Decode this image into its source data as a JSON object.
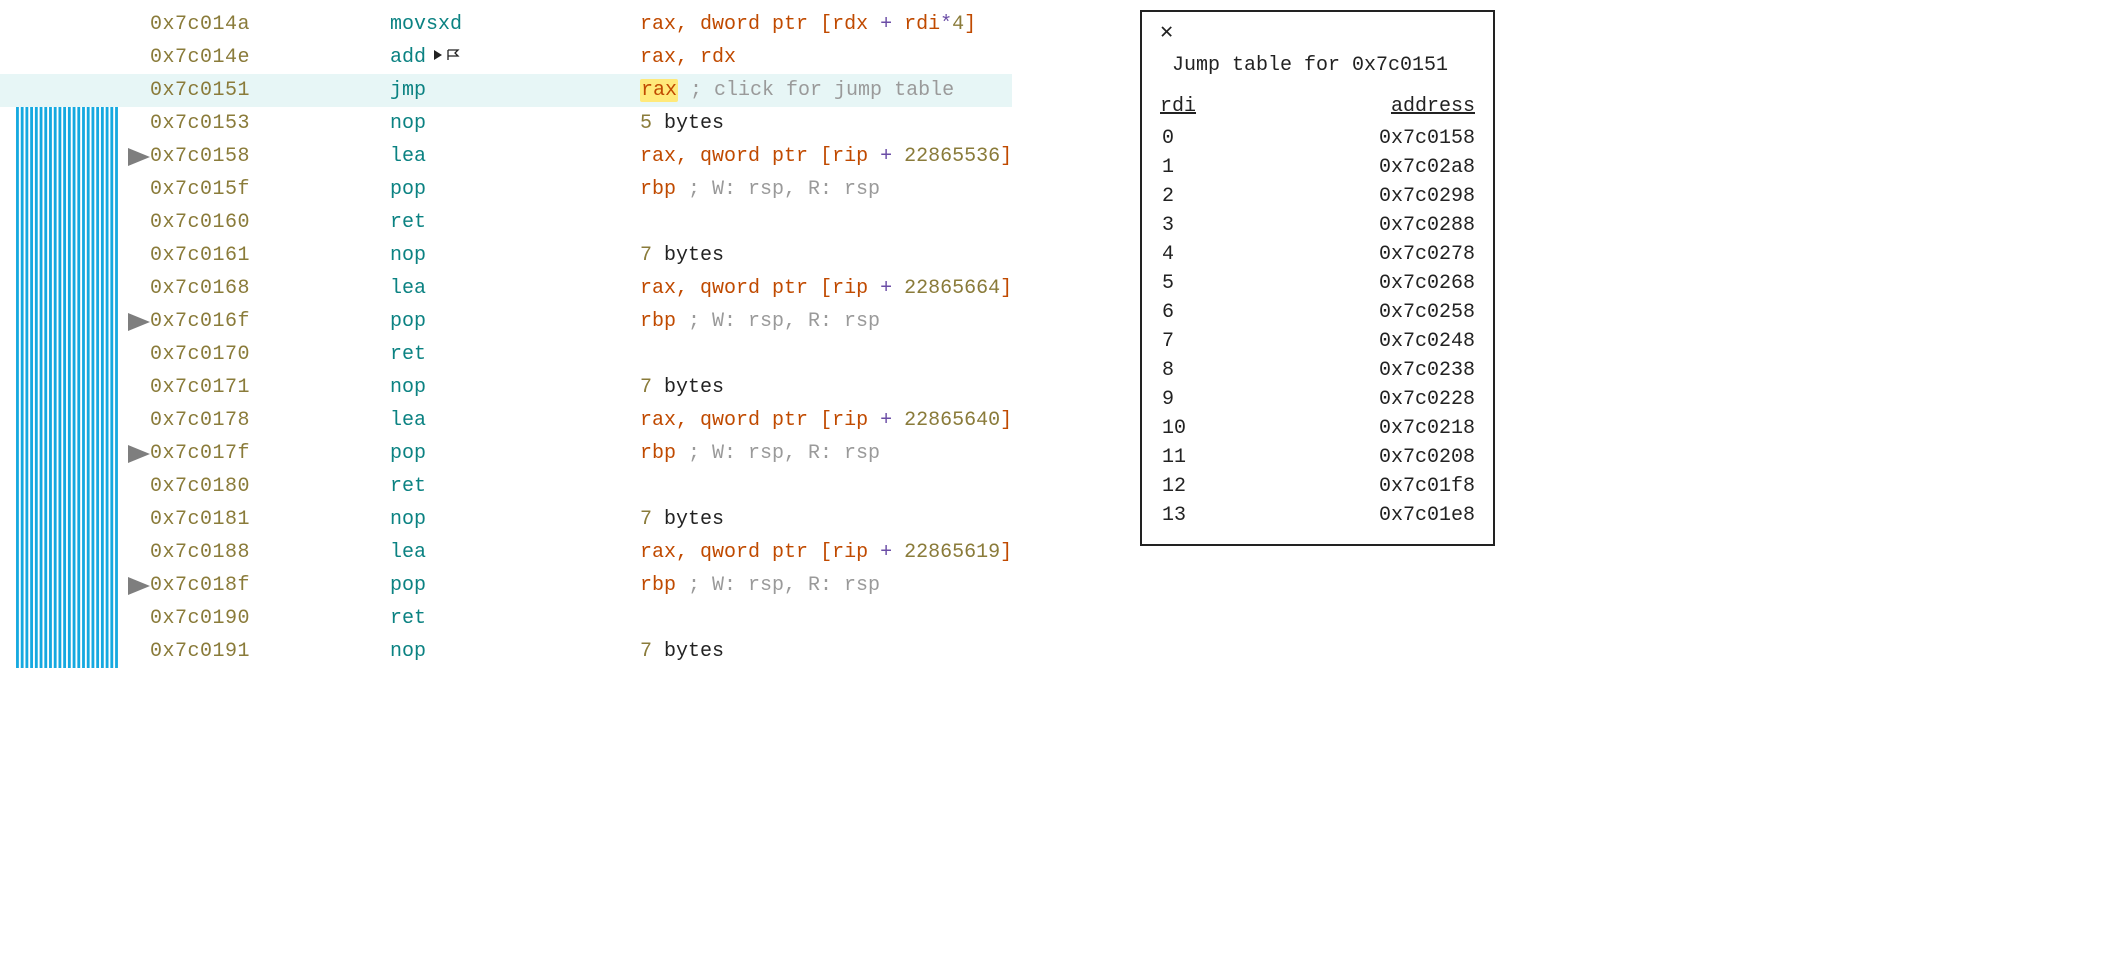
{
  "gutter": {
    "verticalLineCount": 22,
    "jumpSourceRowIndex": 2,
    "arrowTargets": [
      4,
      9,
      13,
      17
    ]
  },
  "rows": [
    {
      "addr": "0x7c014a",
      "mnemonic": "movsxd",
      "highlighted": false,
      "flags": false,
      "operands": [
        {
          "t": "reg",
          "v": "rax"
        },
        {
          "t": "punc",
          "v": ", "
        },
        {
          "t": "kw",
          "v": "dword ptr "
        },
        {
          "t": "punc",
          "v": "["
        },
        {
          "t": "reg",
          "v": "rdx"
        },
        {
          "t": "op",
          "v": " + "
        },
        {
          "t": "reg",
          "v": "rdi"
        },
        {
          "t": "op",
          "v": "*"
        },
        {
          "t": "num",
          "v": "4"
        },
        {
          "t": "punc",
          "v": "]"
        }
      ]
    },
    {
      "addr": "0x7c014e",
      "mnemonic": "add",
      "highlighted": false,
      "flags": true,
      "operands": [
        {
          "t": "reg",
          "v": "rax"
        },
        {
          "t": "punc",
          "v": ", "
        },
        {
          "t": "reg",
          "v": "rdx"
        }
      ]
    },
    {
      "addr": "0x7c0151",
      "mnemonic": "jmp",
      "highlighted": true,
      "flags": false,
      "operands": [
        {
          "t": "reg",
          "v": "rax",
          "hl": true
        },
        {
          "t": "normal",
          "v": " "
        },
        {
          "t": "comment",
          "v": "; click for jump table"
        }
      ]
    },
    {
      "addr": "0x7c0153",
      "mnemonic": "nop",
      "highlighted": false,
      "flags": false,
      "operands": [
        {
          "t": "num",
          "v": "5"
        },
        {
          "t": "normal",
          "v": " bytes"
        }
      ]
    },
    {
      "addr": "0x7c0158",
      "mnemonic": "lea",
      "highlighted": false,
      "flags": false,
      "operands": [
        {
          "t": "reg",
          "v": "rax"
        },
        {
          "t": "punc",
          "v": ", "
        },
        {
          "t": "kw",
          "v": "qword ptr "
        },
        {
          "t": "punc",
          "v": "["
        },
        {
          "t": "reg",
          "v": "rip"
        },
        {
          "t": "op",
          "v": " + "
        },
        {
          "t": "num",
          "v": "22865536"
        },
        {
          "t": "punc",
          "v": "]"
        }
      ]
    },
    {
      "addr": "0x7c015f",
      "mnemonic": "pop",
      "highlighted": false,
      "flags": false,
      "operands": [
        {
          "t": "reg",
          "v": "rbp"
        },
        {
          "t": "normal",
          "v": " "
        },
        {
          "t": "comment",
          "v": "; W: rsp, R: rsp"
        }
      ]
    },
    {
      "addr": "0x7c0160",
      "mnemonic": "ret",
      "highlighted": false,
      "flags": false,
      "operands": []
    },
    {
      "addr": "0x7c0161",
      "mnemonic": "nop",
      "highlighted": false,
      "flags": false,
      "operands": [
        {
          "t": "num",
          "v": "7"
        },
        {
          "t": "normal",
          "v": " bytes"
        }
      ]
    },
    {
      "addr": "0x7c0168",
      "mnemonic": "lea",
      "highlighted": false,
      "flags": false,
      "operands": [
        {
          "t": "reg",
          "v": "rax"
        },
        {
          "t": "punc",
          "v": ", "
        },
        {
          "t": "kw",
          "v": "qword ptr "
        },
        {
          "t": "punc",
          "v": "["
        },
        {
          "t": "reg",
          "v": "rip"
        },
        {
          "t": "op",
          "v": " + "
        },
        {
          "t": "num",
          "v": "22865664"
        },
        {
          "t": "punc",
          "v": "]"
        }
      ]
    },
    {
      "addr": "0x7c016f",
      "mnemonic": "pop",
      "highlighted": false,
      "flags": false,
      "operands": [
        {
          "t": "reg",
          "v": "rbp"
        },
        {
          "t": "normal",
          "v": " "
        },
        {
          "t": "comment",
          "v": "; W: rsp, R: rsp"
        }
      ]
    },
    {
      "addr": "0x7c0170",
      "mnemonic": "ret",
      "highlighted": false,
      "flags": false,
      "operands": []
    },
    {
      "addr": "0x7c0171",
      "mnemonic": "nop",
      "highlighted": false,
      "flags": false,
      "operands": [
        {
          "t": "num",
          "v": "7"
        },
        {
          "t": "normal",
          "v": " bytes"
        }
      ]
    },
    {
      "addr": "0x7c0178",
      "mnemonic": "lea",
      "highlighted": false,
      "flags": false,
      "operands": [
        {
          "t": "reg",
          "v": "rax"
        },
        {
          "t": "punc",
          "v": ", "
        },
        {
          "t": "kw",
          "v": "qword ptr "
        },
        {
          "t": "punc",
          "v": "["
        },
        {
          "t": "reg",
          "v": "rip"
        },
        {
          "t": "op",
          "v": " + "
        },
        {
          "t": "num",
          "v": "22865640"
        },
        {
          "t": "punc",
          "v": "]"
        }
      ]
    },
    {
      "addr": "0x7c017f",
      "mnemonic": "pop",
      "highlighted": false,
      "flags": false,
      "operands": [
        {
          "t": "reg",
          "v": "rbp"
        },
        {
          "t": "normal",
          "v": " "
        },
        {
          "t": "comment",
          "v": "; W: rsp, R: rsp"
        }
      ]
    },
    {
      "addr": "0x7c0180",
      "mnemonic": "ret",
      "highlighted": false,
      "flags": false,
      "operands": []
    },
    {
      "addr": "0x7c0181",
      "mnemonic": "nop",
      "highlighted": false,
      "flags": false,
      "operands": [
        {
          "t": "num",
          "v": "7"
        },
        {
          "t": "normal",
          "v": " bytes"
        }
      ]
    },
    {
      "addr": "0x7c0188",
      "mnemonic": "lea",
      "highlighted": false,
      "flags": false,
      "operands": [
        {
          "t": "reg",
          "v": "rax"
        },
        {
          "t": "punc",
          "v": ", "
        },
        {
          "t": "kw",
          "v": "qword ptr "
        },
        {
          "t": "punc",
          "v": "["
        },
        {
          "t": "reg",
          "v": "rip"
        },
        {
          "t": "op",
          "v": " + "
        },
        {
          "t": "num",
          "v": "22865619"
        },
        {
          "t": "punc",
          "v": "]"
        }
      ]
    },
    {
      "addr": "0x7c018f",
      "mnemonic": "pop",
      "highlighted": false,
      "flags": false,
      "operands": [
        {
          "t": "reg",
          "v": "rbp"
        },
        {
          "t": "normal",
          "v": " "
        },
        {
          "t": "comment",
          "v": "; W: rsp, R: rsp"
        }
      ]
    },
    {
      "addr": "0x7c0190",
      "mnemonic": "ret",
      "highlighted": false,
      "flags": false,
      "operands": []
    },
    {
      "addr": "0x7c0191",
      "mnemonic": "nop",
      "highlighted": false,
      "flags": false,
      "operands": [
        {
          "t": "num",
          "v": "7"
        },
        {
          "t": "normal",
          "v": " bytes"
        }
      ]
    }
  ],
  "popup": {
    "title": "Jump table for 0x7c0151",
    "colIndex": "rdi",
    "colAddr": "address",
    "entries": [
      {
        "idx": "0",
        "addr": "0x7c0158"
      },
      {
        "idx": "1",
        "addr": "0x7c02a8"
      },
      {
        "idx": "2",
        "addr": "0x7c0298"
      },
      {
        "idx": "3",
        "addr": "0x7c0288"
      },
      {
        "idx": "4",
        "addr": "0x7c0278"
      },
      {
        "idx": "5",
        "addr": "0x7c0268"
      },
      {
        "idx": "6",
        "addr": "0x7c0258"
      },
      {
        "idx": "7",
        "addr": "0x7c0248"
      },
      {
        "idx": "8",
        "addr": "0x7c0238"
      },
      {
        "idx": "9",
        "addr": "0x7c0228"
      },
      {
        "idx": "10",
        "addr": "0x7c0218"
      },
      {
        "idx": "11",
        "addr": "0x7c0208"
      },
      {
        "idx": "12",
        "addr": "0x7c01f8"
      },
      {
        "idx": "13",
        "addr": "0x7c01e8"
      }
    ]
  },
  "colors": {
    "accentLines": "#15a9e0",
    "arrowHead": "#7e7e7e"
  }
}
